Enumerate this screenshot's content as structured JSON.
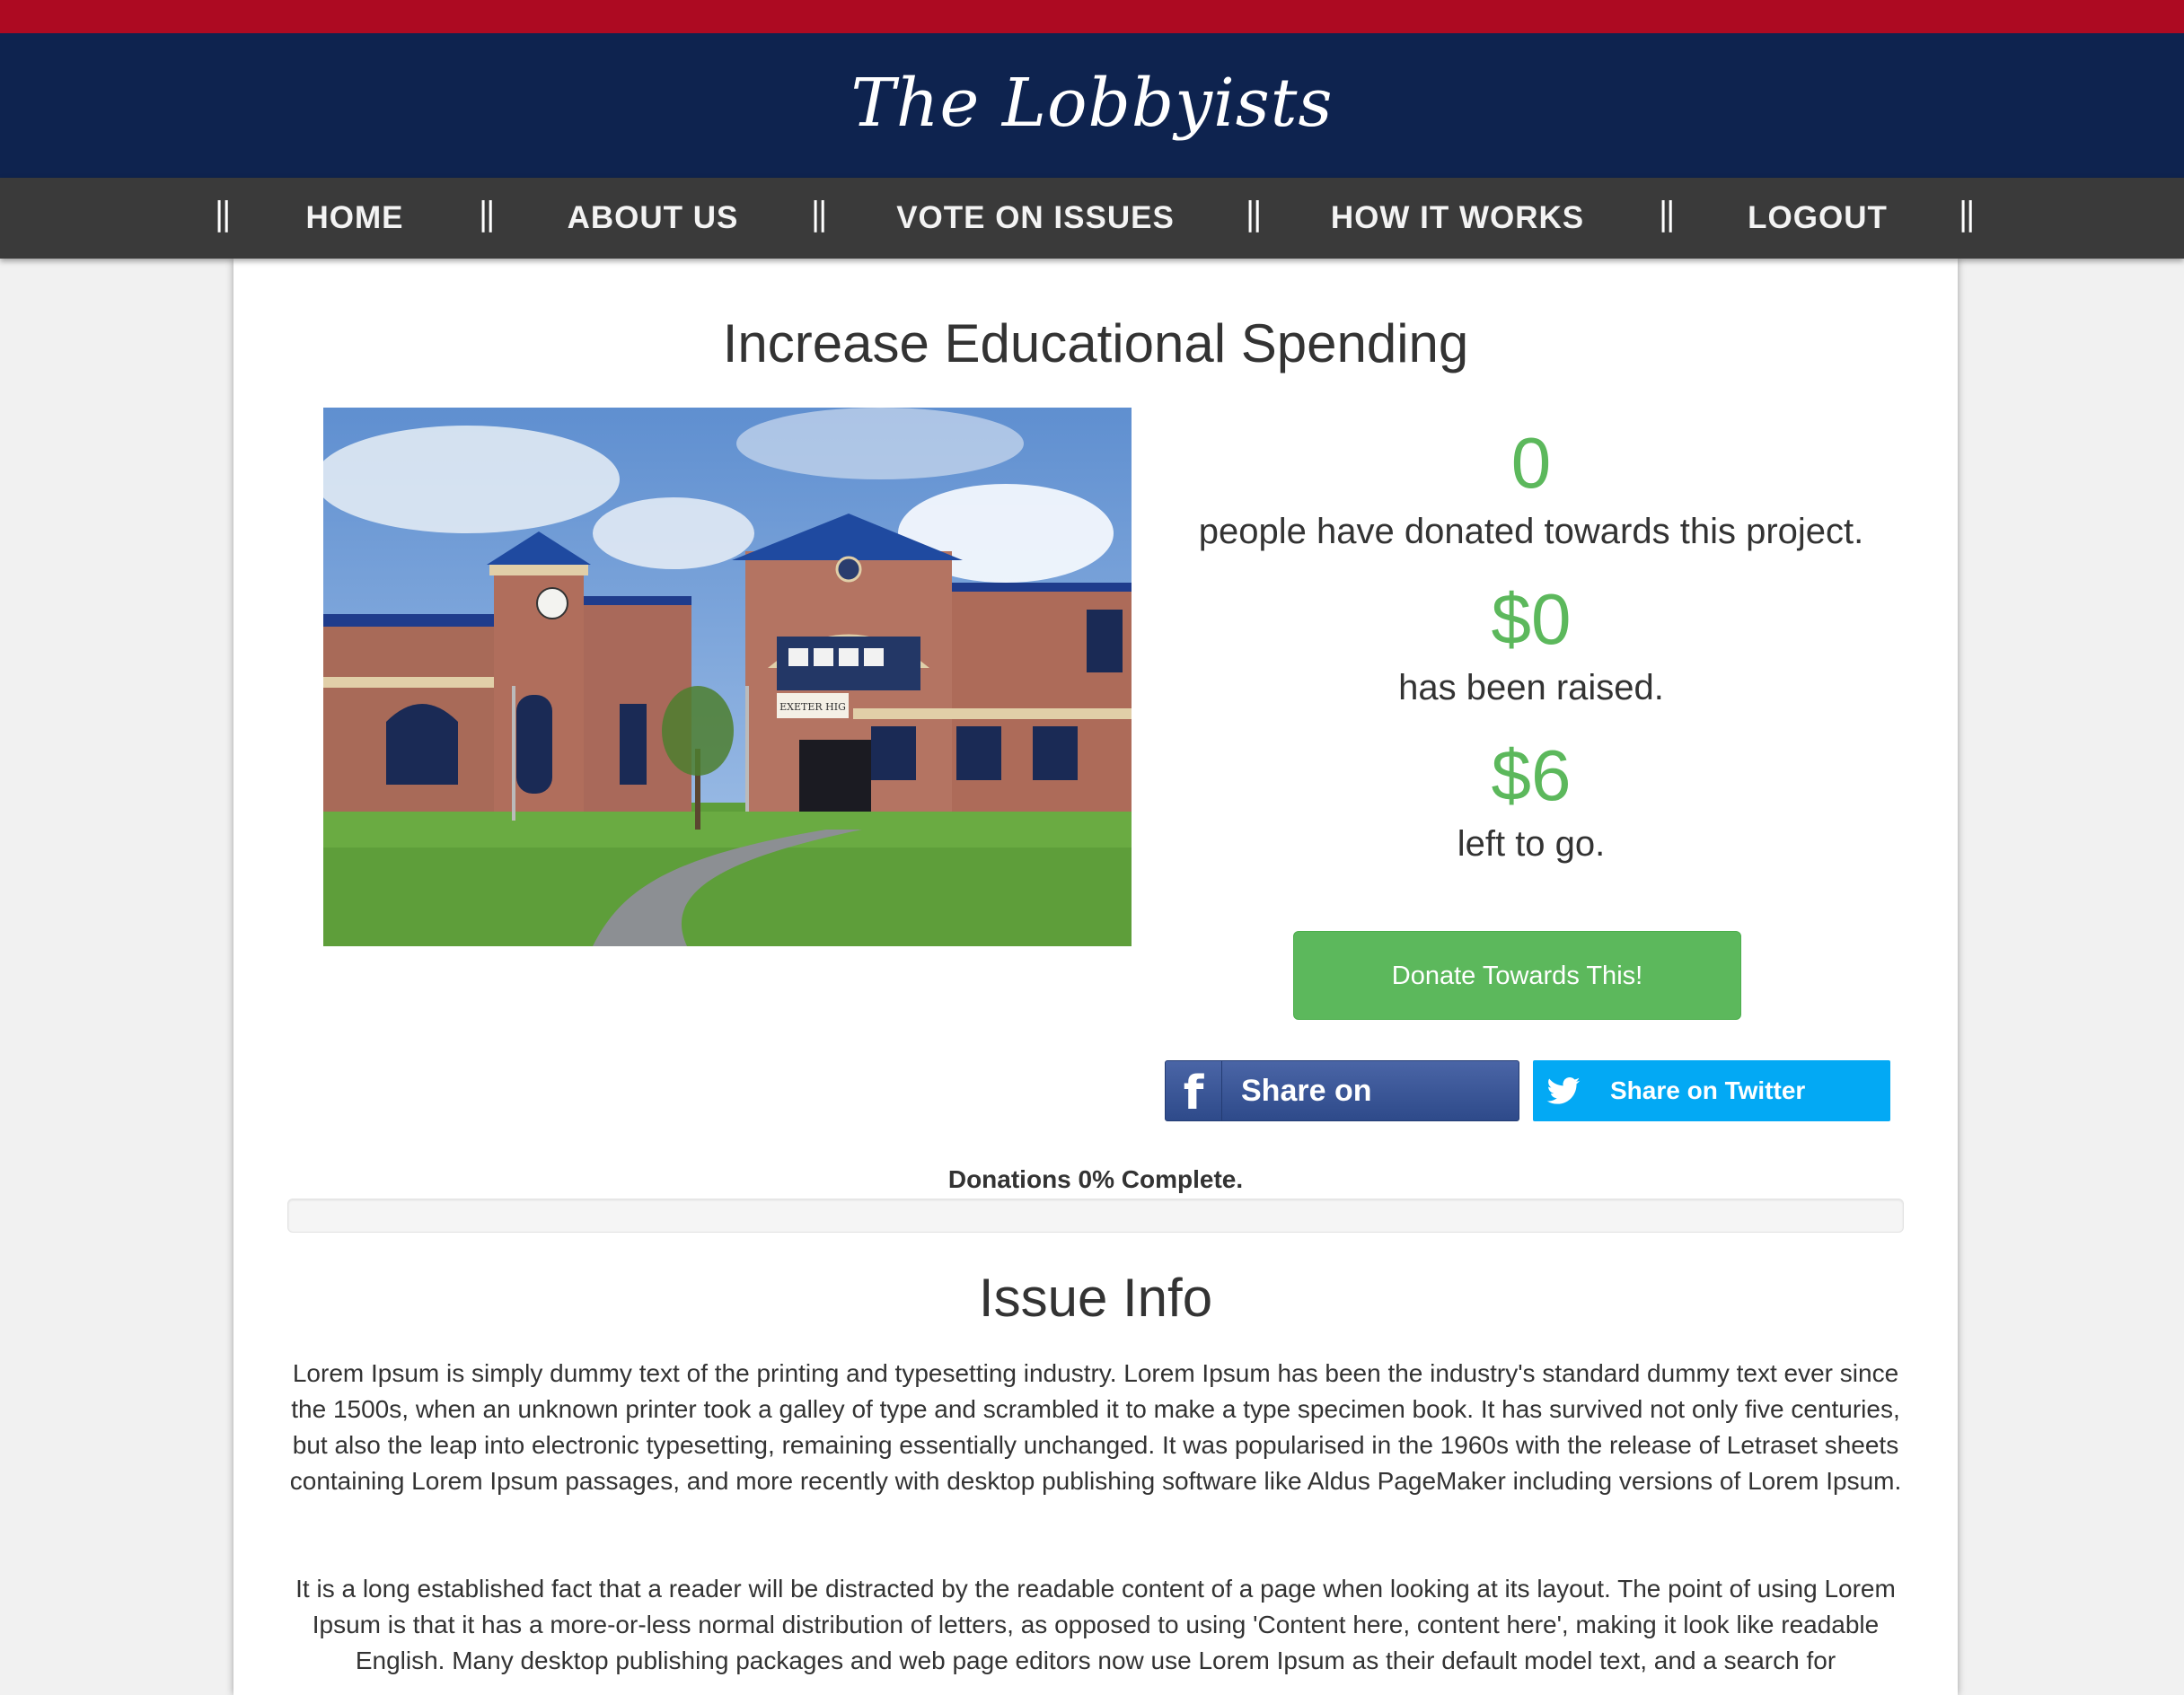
{
  "header": {
    "brand": "The Lobbyists"
  },
  "nav": {
    "items": [
      {
        "label": "HOME"
      },
      {
        "label": "ABOUT US"
      },
      {
        "label": "VOTE ON ISSUES"
      },
      {
        "label": "HOW IT WORKS"
      },
      {
        "label": "LOGOUT"
      }
    ],
    "separator": "||"
  },
  "issue": {
    "title": "Increase Educational Spending",
    "image_sign_text": "EXETER HIG",
    "donors_count": "0",
    "donors_label": "people have donated towards this project.",
    "raised_amount": "$0",
    "raised_label": "has been raised.",
    "remaining_amount": "$6",
    "remaining_label": "left to go.",
    "donate_button": "Donate Towards This!",
    "share_facebook": "Share on Facebook",
    "share_twitter": "Share on Twitter",
    "progress_label": "Donations 0% Complete.",
    "progress_percent": 0
  },
  "info": {
    "title": "Issue Info",
    "paragraph1": "Lorem Ipsum is simply dummy text of the printing and typesetting industry. Lorem Ipsum has been the industry's standard dummy text ever since the 1500s, when an unknown printer took a galley of type and scrambled it to make a type specimen book. It has survived not only five centuries, but also the leap into electronic typesetting, remaining essentially unchanged. It was popularised in the 1960s with the release of Letraset sheets containing Lorem Ipsum passages, and more recently with desktop publishing software like Aldus PageMaker including versions of Lorem Ipsum.",
    "paragraph2": "It is a long established fact that a reader will be distracted by the readable content of a page when looking at its layout. The point of using Lorem Ipsum is that it has a more-or-less normal distribution of letters, as opposed to using 'Content here, content here', making it look like readable English. Many desktop publishing packages and web page editors now use Lorem Ipsum as their default model text, and a search for"
  },
  "colors": {
    "top_stripe": "#ad0a22",
    "brand_bar": "#0e234f",
    "nav_bar": "#3a3a3a",
    "accent_green": "#5cb85c",
    "facebook_blue": "#3b5998",
    "twitter_blue": "#03a9f4"
  },
  "icons": {
    "facebook": "facebook-icon",
    "twitter": "twitter-bird-icon"
  }
}
